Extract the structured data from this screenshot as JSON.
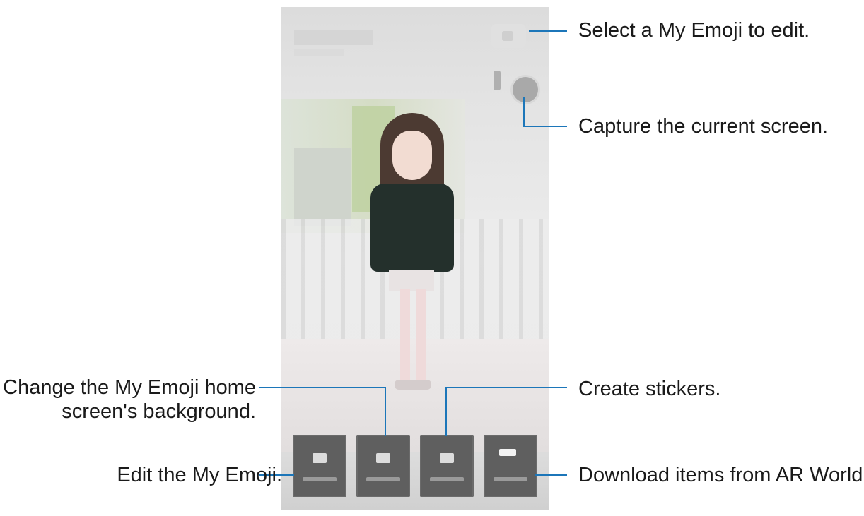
{
  "callouts": {
    "select_emoji": "Select a My Emoji to edit.",
    "capture": "Capture the current screen.",
    "create_stickers": "Create stickers.",
    "download_ar": "Download items from AR World.",
    "change_bg_line1": "Change the My Emoji home",
    "change_bg_line2": "screen's background.",
    "edit_emoji": "Edit the My Emoji."
  },
  "colors": {
    "callout_line": "#1c76b9",
    "menu_button": "#5f5f5f"
  },
  "icons": {
    "capture": "camera-icon",
    "select": "emoji-select-icon"
  }
}
